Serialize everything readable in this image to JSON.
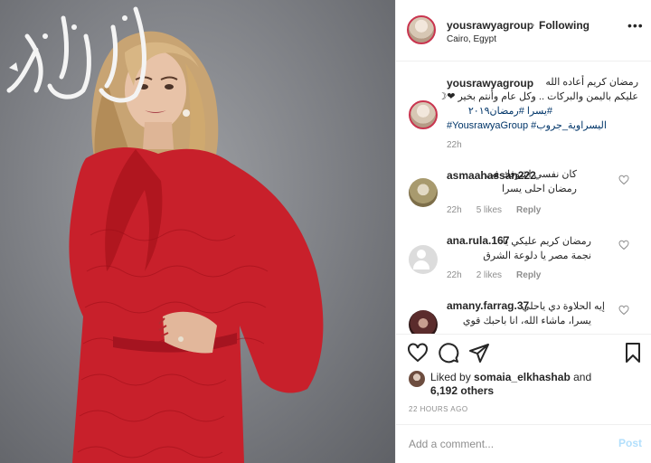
{
  "header": {
    "username": "yousrawyagroup",
    "separator": "•",
    "follow_status": "Following",
    "location": "Cairo, Egypt",
    "more_label": "•••"
  },
  "caption": {
    "username": "yousrawyagroup",
    "line1": "رمضان كريم أعاده الله",
    "line2": "عليكم باليمن والبركات .. وكل عام وأنتم بخير ❤☽",
    "hashtags1": "#يسرا #رمضان٢٠١٩",
    "hashtags2": "#YousrawyaGroup #اليسراوية_جروب",
    "time": "22h"
  },
  "comments": [
    {
      "username": "asmaahassan222",
      "text_line1": "كان نفسي اشوفك فى",
      "text_line2": "رمضان احلى يسرا",
      "time": "22h",
      "likes": "5 likes",
      "reply": "Reply"
    },
    {
      "username": "ana.rula.167",
      "text_line1": "رمضان كريم عليكي يا",
      "text_line2": "نجمة مصر يا دلوعة الشرق",
      "time": "22h",
      "likes": "2 likes",
      "reply": "Reply"
    },
    {
      "username": "amany.farrag.37",
      "text_line1": "إيه الحلاوة دي ياحلي",
      "text_line2": "يسرا، ماشاء الله، انا باحبك قوي",
      "time": "",
      "likes": "",
      "reply": ""
    }
  ],
  "likes": {
    "prefix": "Liked by",
    "liker": "somaia_elkhashab",
    "and": "and",
    "others": "6,192 others"
  },
  "post_time": "22 HOURS AGO",
  "comment_box": {
    "placeholder": "Add a comment...",
    "post_label": "Post"
  },
  "icons": {
    "like": "heart-icon",
    "comment": "comment-bubble-icon",
    "share": "paper-plane-icon",
    "save": "bookmark-icon"
  },
  "colors": {
    "dress": "#c8202b",
    "background": "#7f8186",
    "link": "#003569",
    "post_button": "#b2dffc"
  }
}
